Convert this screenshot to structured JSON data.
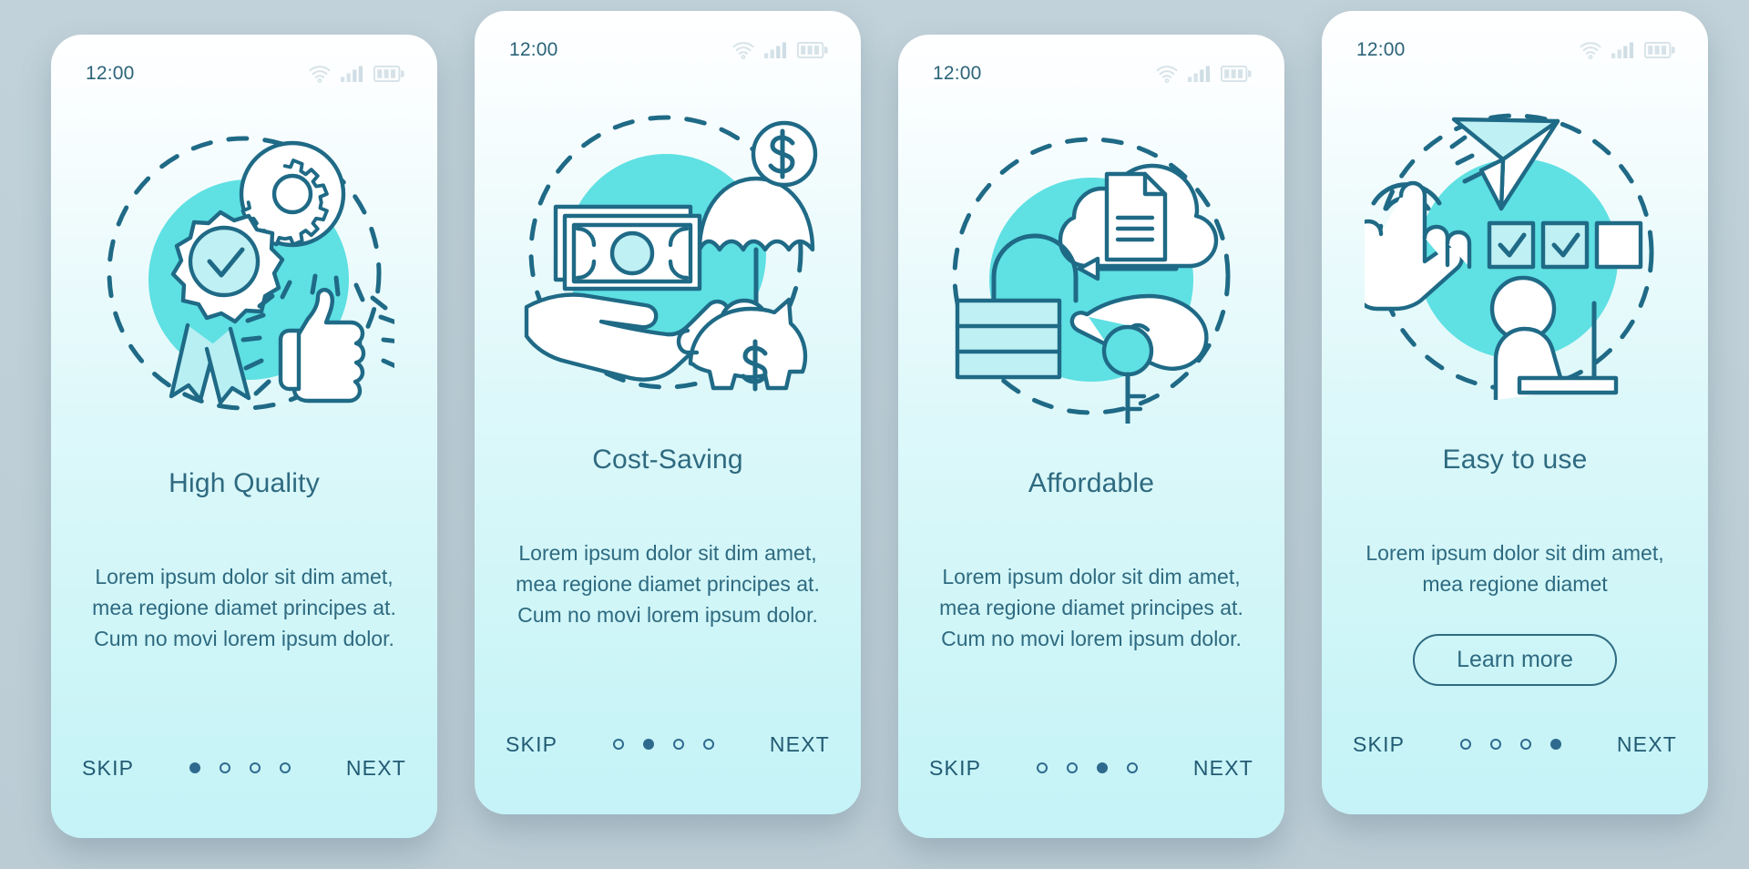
{
  "background_color": "#bccfd8",
  "palette": {
    "ink": "#2e6a80",
    "line": "#1f6a86",
    "accent_circle": "#57dfe2",
    "accent_fill": "#bff0f4",
    "nav": "#215a73",
    "dot": "#2f6a8e",
    "card_top": "#ffffff",
    "card_bottom": "#c5f3f7"
  },
  "status_bar": {
    "time": "12:00",
    "icons": [
      "wifi-icon",
      "signal-icon",
      "battery-icon"
    ]
  },
  "nav": {
    "skip_label": "SKIP",
    "next_label": "NEXT",
    "dot_count": 4
  },
  "screens": [
    {
      "id": "high-quality",
      "title": "High Quality",
      "body": "Lorem ipsum dolor sit dim amet, mea regione diamet principes at. Cum no movi lorem ipsum dolor.",
      "active_dot": 1,
      "illustration": "award-gear-thumbsup-illustration",
      "illustration_parts": [
        "ribbon-award-icon",
        "checkmark-icon",
        "gear-icon",
        "thumbs-up-icon",
        "dashed-circle"
      ],
      "cta": null
    },
    {
      "id": "cost-saving",
      "title": "Cost-Saving",
      "body": "Lorem ipsum dolor sit dim amet, mea regione diamet principes at. Cum no movi lorem ipsum dolor.",
      "active_dot": 2,
      "illustration": "money-umbrella-piggybank-illustration",
      "illustration_parts": [
        "banknotes-icon",
        "open-hand-icon",
        "umbrella-icon",
        "dollar-coin-icon",
        "piggy-bank-icon",
        "dashed-circle"
      ],
      "cta": null
    },
    {
      "id": "affordable",
      "title": "Affordable",
      "body": "Lorem ipsum dolor sit dim amet, mea regione diamet principes at. Cum no movi lorem ipsum dolor.",
      "active_dot": 3,
      "illustration": "padlock-cloud-key-illustration",
      "illustration_parts": [
        "padlock-icon",
        "cloud-icon",
        "document-icon",
        "arrow-left-icon",
        "hand-key-icon",
        "dashed-circle"
      ],
      "cta": null
    },
    {
      "id": "easy-to-use",
      "title": "Easy to use",
      "body": "Lorem ipsum dolor sit dim amet, mea regione diamet",
      "active_dot": 4,
      "illustration": "tap-checkboxes-person-illustration",
      "illustration_parts": [
        "tap-hand-icon",
        "paper-plane-icon",
        "checkbox-checked-icon",
        "checkbox-checked-icon",
        "checkbox-empty-icon",
        "person-laptop-icon",
        "dashed-circle"
      ],
      "cta": "Learn more"
    }
  ]
}
